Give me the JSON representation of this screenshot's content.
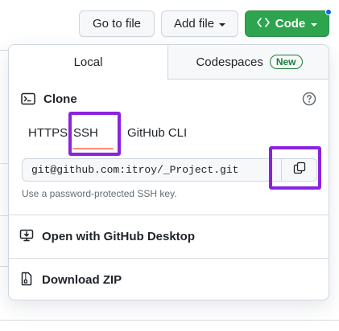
{
  "toolbar": {
    "go_to_file": "Go to file",
    "add_file": "Add file",
    "code": "Code",
    "code_icon": "code-brackets-icon",
    "notification_dot_color": "#0969da"
  },
  "panel": {
    "tabs": [
      {
        "label": "Local",
        "selected": true
      },
      {
        "label": "Codespaces",
        "selected": false,
        "badge": "New"
      }
    ],
    "clone": {
      "title": "Clone",
      "icon": "terminal-icon",
      "help_icon": "question-icon",
      "protocols": [
        {
          "label": "HTTPS",
          "selected": false
        },
        {
          "label": "SSH",
          "selected": true
        },
        {
          "label": "GitHub CLI",
          "selected": false
        }
      ],
      "url": "git@github.com:itroy/_Project.git",
      "copy_icon": "copy-icon",
      "hint": "Use a password-protected SSH key."
    },
    "actions": [
      {
        "label": "Open with GitHub Desktop",
        "icon": "desktop-download-icon"
      },
      {
        "label": "Download ZIP",
        "icon": "file-zip-icon"
      }
    ]
  },
  "colors": {
    "primary_green": "#2da44e",
    "accent_underline": "#fd8c73",
    "badge_green": "#1a7f37",
    "annotation_purple": "#8a22e0"
  }
}
